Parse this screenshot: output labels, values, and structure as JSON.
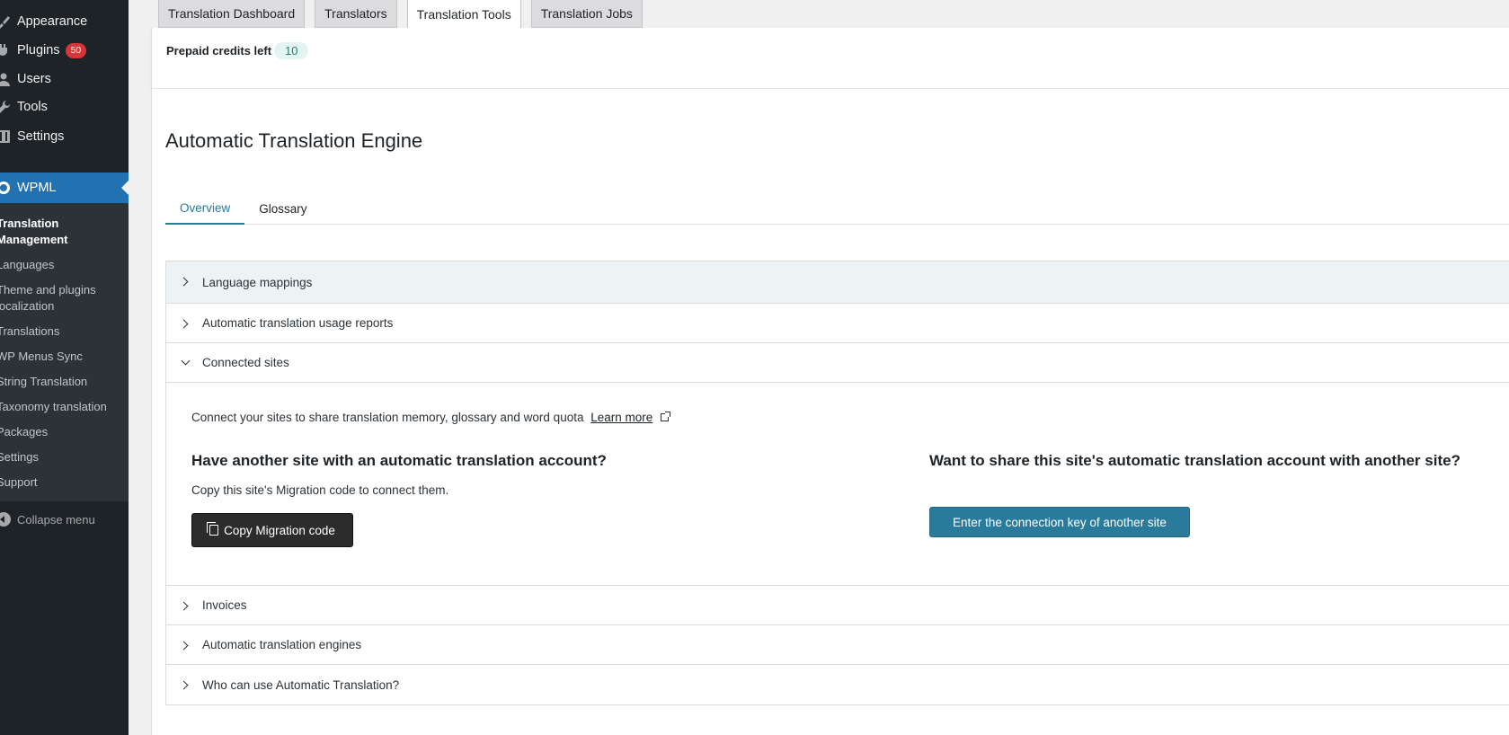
{
  "sidebar": {
    "menu": [
      {
        "label": "Appearance",
        "icon": "paintbrush-icon"
      },
      {
        "label": "Plugins",
        "icon": "plugin-icon",
        "badge": "50"
      },
      {
        "label": "Users",
        "icon": "user-icon"
      },
      {
        "label": "Tools",
        "icon": "wrench-icon"
      },
      {
        "label": "Settings",
        "icon": "settings-icon"
      }
    ],
    "active": {
      "label": "WPML",
      "icon": "wpml-icon"
    },
    "submenu": [
      "Translation Management",
      "Languages",
      "Theme and plugins localization",
      "Translations",
      "WP Menus Sync",
      "String Translation",
      "Taxonomy translation",
      "Packages",
      "Settings",
      "Support"
    ],
    "collapse_label": "Collapse menu"
  },
  "tabs": [
    "Translation Dashboard",
    "Translators",
    "Translation Tools",
    "Translation Jobs"
  ],
  "active_tab": "Translation Tools",
  "credits": {
    "label": "Prepaid credits left",
    "value": "10"
  },
  "engine": {
    "title": "Automatic Translation Engine",
    "subtabs": [
      "Overview",
      "Glossary"
    ],
    "sections": [
      "Language mappings",
      "Automatic translation usage reports",
      "Connected sites",
      "Invoices",
      "Automatic translation engines",
      "Who can use Automatic Translation?"
    ]
  },
  "connected_sites": {
    "intro": "Connect your sites to share translation memory, glossary and word quota",
    "learn_more": "Learn more",
    "left_title": "Have another site with an automatic translation account?",
    "left_desc": "Copy this site's Migration code to connect them.",
    "copy_button": "Copy Migration code",
    "right_title": "Want to share this site's automatic translation account with another site?",
    "connect_button": "Enter the connection key of another site"
  },
  "colors": {
    "accent": "#2a7b9b",
    "admin_blue": "#2271b1",
    "sidebar_bg": "#1d2327"
  }
}
